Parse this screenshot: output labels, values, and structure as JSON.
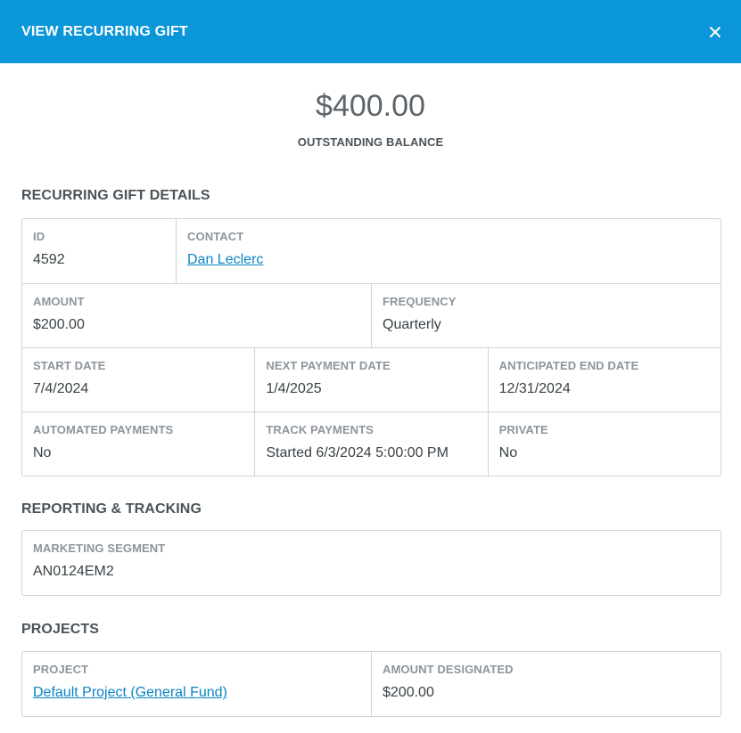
{
  "header": {
    "title": "VIEW RECURRING GIFT",
    "close_icon": "close-icon"
  },
  "balance": {
    "amount": "$400.00",
    "label": "OUTSTANDING BALANCE"
  },
  "details": {
    "title": "RECURRING GIFT DETAILS",
    "id": {
      "label": "ID",
      "value": "4592"
    },
    "contact": {
      "label": "CONTACT",
      "value": "Dan Leclerc"
    },
    "amount": {
      "label": "AMOUNT",
      "value": "$200.00"
    },
    "frequency": {
      "label": "FREQUENCY",
      "value": "Quarterly"
    },
    "start_date": {
      "label": "START DATE",
      "value": "7/4/2024"
    },
    "next_payment_date": {
      "label": "NEXT PAYMENT DATE",
      "value": "1/4/2025"
    },
    "anticipated_end_date": {
      "label": "ANTICIPATED END DATE",
      "value": "12/31/2024"
    },
    "automated_payments": {
      "label": "AUTOMATED PAYMENTS",
      "value": "No"
    },
    "track_payments": {
      "label": "TRACK PAYMENTS",
      "value": "Started 6/3/2024 5:00:00 PM"
    },
    "private": {
      "label": "PRIVATE",
      "value": "No"
    }
  },
  "reporting": {
    "title": "REPORTING & TRACKING",
    "marketing_segment": {
      "label": "MARKETING SEGMENT",
      "value": "AN0124EM2"
    }
  },
  "projects": {
    "title": "PROJECTS",
    "project": {
      "label": "PROJECT",
      "value": "Default Project (General Fund)"
    },
    "amount_designated": {
      "label": "AMOUNT DESIGNATED",
      "value": "$200.00"
    }
  },
  "colors": {
    "header_bg": "#0a96d9",
    "link": "#0a84c6"
  }
}
